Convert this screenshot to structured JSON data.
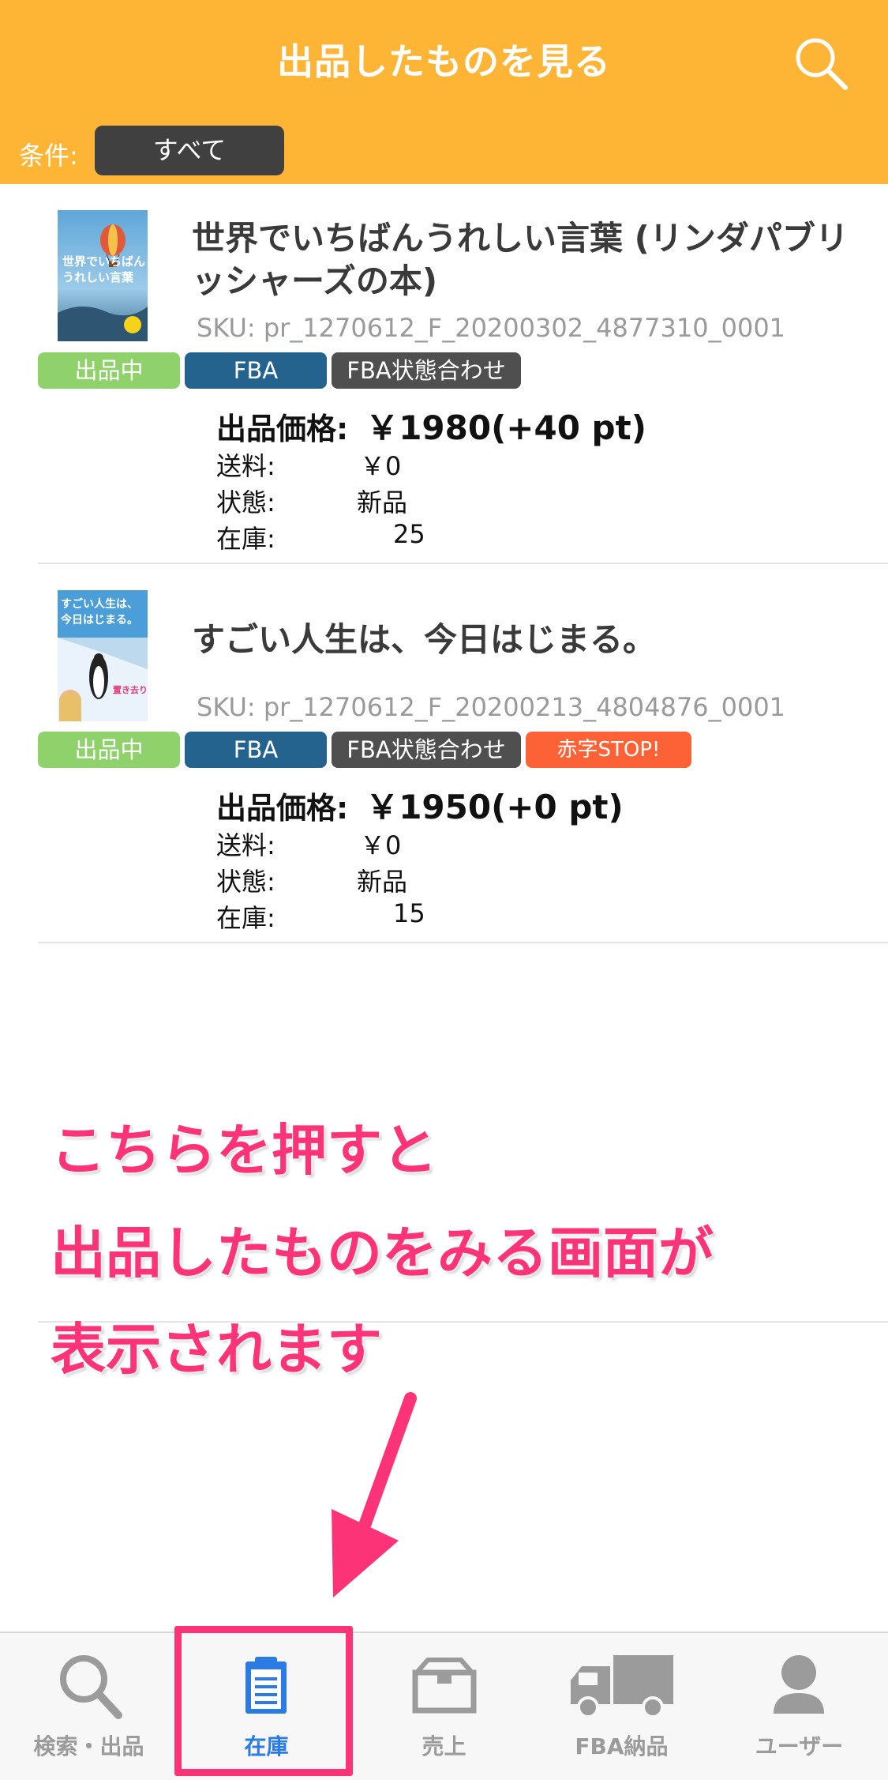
{
  "header": {
    "title": "出品したものを見る",
    "filter_label": "条件:",
    "filter_value": "すべて"
  },
  "products": [
    {
      "title": "世界でいちばんうれしい言葉 (リンダパブリッシャーズの本)",
      "sku": "SKU: pr_1270612_F_20200302_4877310_0001",
      "badges": [
        "出品中",
        "FBA",
        "FBA状態合わせ"
      ],
      "price_label": "出品価格:",
      "price_value": "￥1980(+40 pt)",
      "shipping_label": "送料:",
      "shipping_value": "￥0",
      "condition_label": "状態:",
      "condition_value": "新品",
      "stock_label": "在庫:",
      "stock_value": "25",
      "cover": {
        "top_text": "世界でいちばん",
        "bottom_text": "うれしい言葉"
      }
    },
    {
      "title": "すごい人生は、今日はじまる。",
      "sku": "SKU: pr_1270612_F_20200213_4804876_0001",
      "badges": [
        "出品中",
        "FBA",
        "FBA状態合わせ",
        "赤字STOP!"
      ],
      "price_label": "出品価格:",
      "price_value": "￥1950(+0 pt)",
      "shipping_label": "送料:",
      "shipping_value": "￥0",
      "condition_label": "状態:",
      "condition_value": "新品",
      "stock_label": "在庫:",
      "stock_value": "15",
      "cover": {
        "top_text": "すごい人生は、",
        "bottom_text": "今日はじまる。"
      }
    }
  ],
  "annotation": {
    "lines": [
      "こちらを押すと",
      "出品したものをみる画面が",
      "表示されます"
    ]
  },
  "tabbar": {
    "items": [
      {
        "label": "検索・出品",
        "icon": "search-icon",
        "active": false
      },
      {
        "label": "在庫",
        "icon": "clipboard-icon",
        "active": true
      },
      {
        "label": "売上",
        "icon": "box-icon",
        "active": false
      },
      {
        "label": "FBA納品",
        "icon": "truck-icon",
        "active": false
      },
      {
        "label": "ユーザー",
        "icon": "user-icon",
        "active": false
      }
    ]
  },
  "colors": {
    "header_bg": "#feb535",
    "status_badge": "#8fd26b",
    "fba_badge": "#24638e",
    "condition_badge": "#4f4f4f",
    "stop_badge": "#fd6236",
    "annotation": "#fd3377",
    "active_tab": "#2a7be3"
  }
}
